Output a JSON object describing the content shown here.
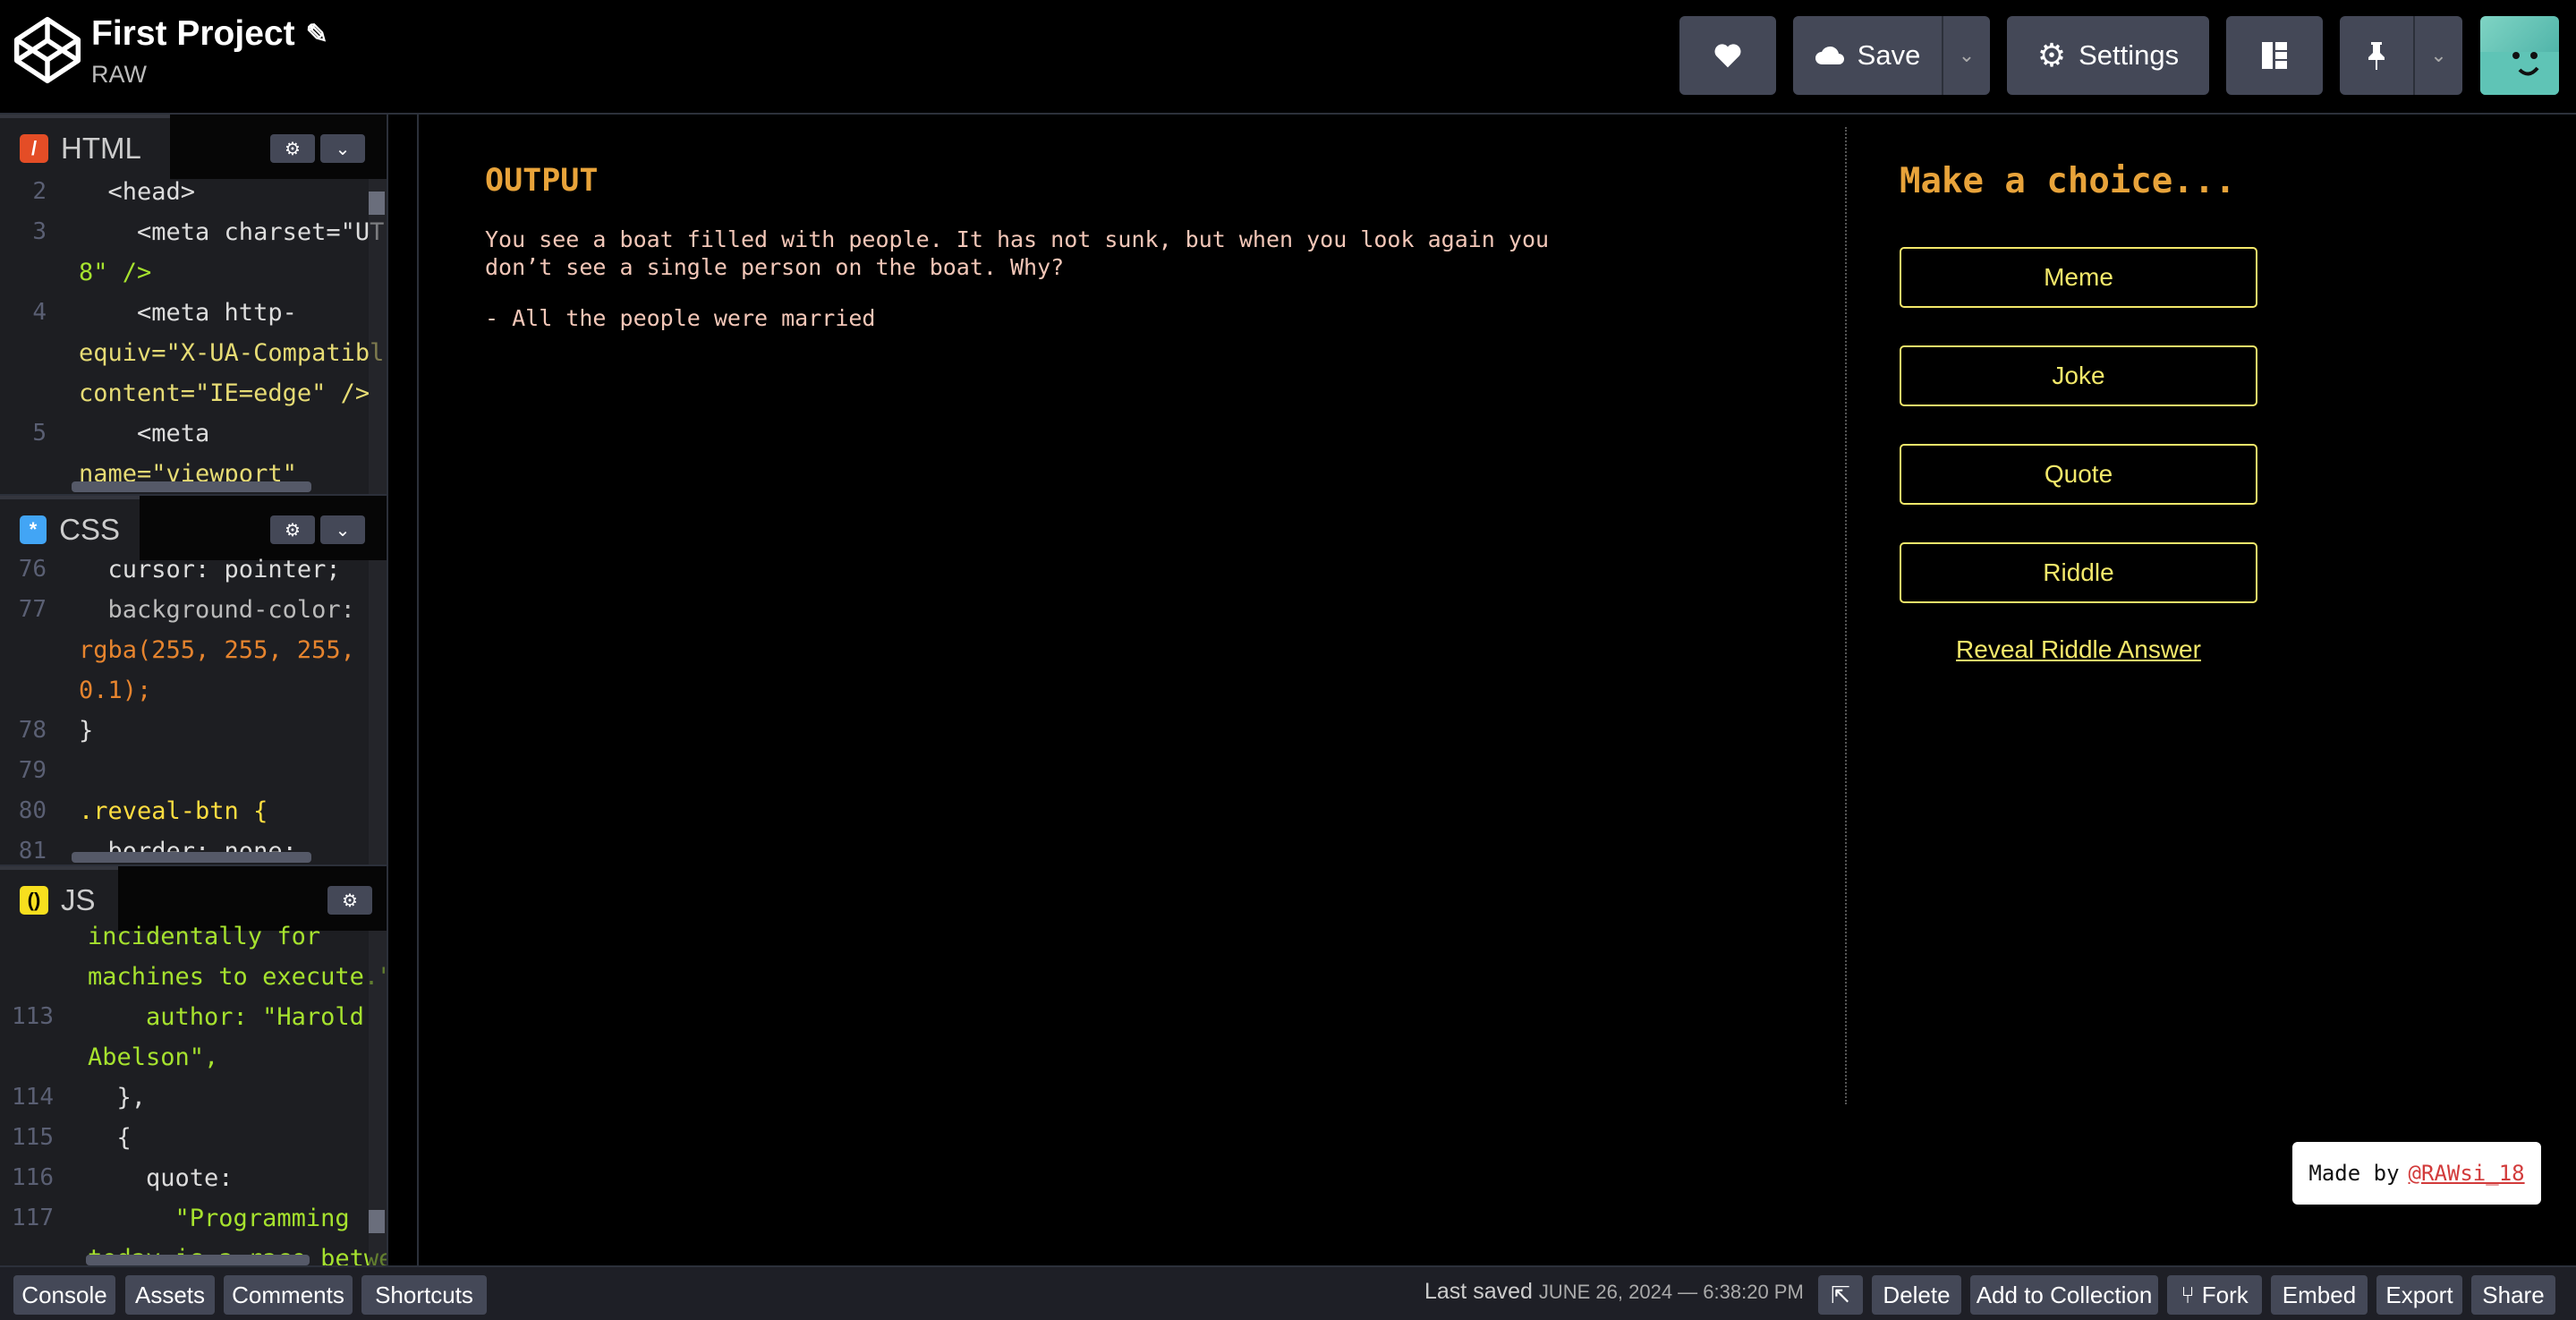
{
  "header": {
    "title": "First Project",
    "edit_icon": "pencil-icon",
    "user": "RAW",
    "buttons": {
      "like_icon": "heart-icon",
      "save_label": "Save",
      "save_icon": "cloud-icon",
      "settings_label": "Settings",
      "settings_icon": "gear-icon",
      "layout_icon": "layout-icon",
      "pin_icon": "pin-icon"
    }
  },
  "editors": {
    "html": {
      "label": "HTML",
      "color": "#e44d26",
      "lines": [
        {
          "n": "2",
          "t": "  <head>"
        },
        {
          "n": "3",
          "t": "    <meta charset=\"UT"
        },
        {
          "n": "",
          "t": "8\" />"
        },
        {
          "n": "4",
          "t": "    <meta http-"
        },
        {
          "n": "",
          "t": "equiv=\"X-UA-Compatibl"
        },
        {
          "n": "",
          "t": "content=\"IE=edge\" />"
        },
        {
          "n": "5",
          "t": "    <meta"
        },
        {
          "n": "",
          "t": "name=\"viewport\""
        }
      ]
    },
    "css": {
      "label": "CSS",
      "color": "#42a5f5",
      "lines": [
        {
          "n": "76",
          "t": "  cursor: pointer;"
        },
        {
          "n": "77",
          "t": "  background-color:"
        },
        {
          "n": "",
          "t": "rgba(255, 255, 255,"
        },
        {
          "n": "",
          "t": "0.1);"
        },
        {
          "n": "78",
          "t": "}"
        },
        {
          "n": "79",
          "t": ""
        },
        {
          "n": "80",
          "t": ".reveal-btn {"
        },
        {
          "n": "81",
          "t": "  border: none;"
        }
      ]
    },
    "js": {
      "label": "JS",
      "color": "#f7df1e",
      "lines": [
        {
          "n": "",
          "t": "incidentally for"
        },
        {
          "n": "",
          "t": "machines to execute.\""
        },
        {
          "n": "113",
          "t": "    author: \"Harold"
        },
        {
          "n": "",
          "t": "Abelson\","
        },
        {
          "n": "114",
          "t": "  },"
        },
        {
          "n": "115",
          "t": "  {"
        },
        {
          "n": "116",
          "t": "    quote:"
        },
        {
          "n": "117",
          "t": "      \"Programming"
        },
        {
          "n": "",
          "t": "today is a race betwe"
        }
      ]
    }
  },
  "preview": {
    "output_title": "OUTPUT",
    "riddle_text": "You see a boat filled with people. It has not sunk, but when you look again you don’t see a single person on the boat. Why?",
    "answer_text": "- All the people were married",
    "choice_title": "Make a choice...",
    "choices": [
      "Meme",
      "Joke",
      "Quote",
      "Riddle"
    ],
    "reveal_label": "Reveal Riddle Answer",
    "made_by_prefix": "Made by",
    "made_by_link": "@RAWsi_18"
  },
  "footer": {
    "console": "Console",
    "assets": "Assets",
    "comments": "Comments",
    "shortcuts": "Shortcuts",
    "last_saved_label": "Last saved",
    "last_saved_value": "JUNE 26, 2024 — 6:38:20 PM",
    "external_icon": "external-link-icon",
    "delete": "Delete",
    "add_to_collection": "Add to Collection",
    "fork": "Fork",
    "fork_icon": "fork-icon",
    "embed": "Embed",
    "export": "Export",
    "share": "Share"
  },
  "colors": {
    "accent_orange": "#e8a33a",
    "button_yellow": "#f3e86a",
    "toolbar_gray": "#444857"
  }
}
